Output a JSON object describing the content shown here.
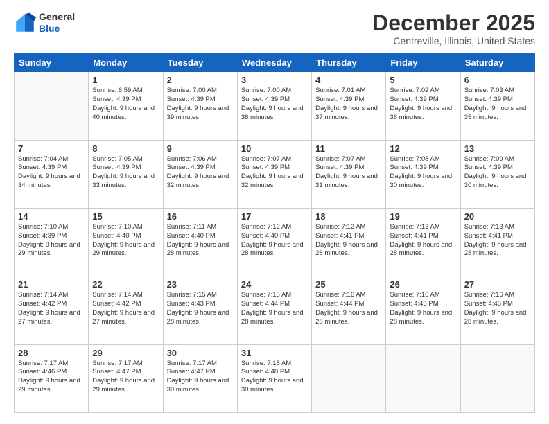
{
  "header": {
    "logo_general": "General",
    "logo_blue": "Blue",
    "month_year": "December 2025",
    "location": "Centreville, Illinois, United States"
  },
  "days_of_week": [
    "Sunday",
    "Monday",
    "Tuesday",
    "Wednesday",
    "Thursday",
    "Friday",
    "Saturday"
  ],
  "weeks": [
    [
      {
        "day": "",
        "sunrise": "",
        "sunset": "",
        "daylight": "",
        "empty": true
      },
      {
        "day": "1",
        "sunrise": "6:59 AM",
        "sunset": "4:39 PM",
        "daylight": "9 hours and 40 minutes."
      },
      {
        "day": "2",
        "sunrise": "7:00 AM",
        "sunset": "4:39 PM",
        "daylight": "9 hours and 39 minutes."
      },
      {
        "day": "3",
        "sunrise": "7:00 AM",
        "sunset": "4:39 PM",
        "daylight": "9 hours and 38 minutes."
      },
      {
        "day": "4",
        "sunrise": "7:01 AM",
        "sunset": "4:39 PM",
        "daylight": "9 hours and 37 minutes."
      },
      {
        "day": "5",
        "sunrise": "7:02 AM",
        "sunset": "4:39 PM",
        "daylight": "9 hours and 36 minutes."
      },
      {
        "day": "6",
        "sunrise": "7:03 AM",
        "sunset": "4:39 PM",
        "daylight": "9 hours and 35 minutes."
      }
    ],
    [
      {
        "day": "7",
        "sunrise": "7:04 AM",
        "sunset": "4:39 PM",
        "daylight": "9 hours and 34 minutes."
      },
      {
        "day": "8",
        "sunrise": "7:05 AM",
        "sunset": "4:39 PM",
        "daylight": "9 hours and 33 minutes."
      },
      {
        "day": "9",
        "sunrise": "7:06 AM",
        "sunset": "4:39 PM",
        "daylight": "9 hours and 32 minutes."
      },
      {
        "day": "10",
        "sunrise": "7:07 AM",
        "sunset": "4:39 PM",
        "daylight": "9 hours and 32 minutes."
      },
      {
        "day": "11",
        "sunrise": "7:07 AM",
        "sunset": "4:39 PM",
        "daylight": "9 hours and 31 minutes."
      },
      {
        "day": "12",
        "sunrise": "7:08 AM",
        "sunset": "4:39 PM",
        "daylight": "9 hours and 30 minutes."
      },
      {
        "day": "13",
        "sunrise": "7:09 AM",
        "sunset": "4:39 PM",
        "daylight": "9 hours and 30 minutes."
      }
    ],
    [
      {
        "day": "14",
        "sunrise": "7:10 AM",
        "sunset": "4:39 PM",
        "daylight": "9 hours and 29 minutes."
      },
      {
        "day": "15",
        "sunrise": "7:10 AM",
        "sunset": "4:40 PM",
        "daylight": "9 hours and 29 minutes."
      },
      {
        "day": "16",
        "sunrise": "7:11 AM",
        "sunset": "4:40 PM",
        "daylight": "9 hours and 28 minutes."
      },
      {
        "day": "17",
        "sunrise": "7:12 AM",
        "sunset": "4:40 PM",
        "daylight": "9 hours and 28 minutes."
      },
      {
        "day": "18",
        "sunrise": "7:12 AM",
        "sunset": "4:41 PM",
        "daylight": "9 hours and 28 minutes."
      },
      {
        "day": "19",
        "sunrise": "7:13 AM",
        "sunset": "4:41 PM",
        "daylight": "9 hours and 28 minutes."
      },
      {
        "day": "20",
        "sunrise": "7:13 AM",
        "sunset": "4:41 PM",
        "daylight": "9 hours and 28 minutes."
      }
    ],
    [
      {
        "day": "21",
        "sunrise": "7:14 AM",
        "sunset": "4:42 PM",
        "daylight": "9 hours and 27 minutes."
      },
      {
        "day": "22",
        "sunrise": "7:14 AM",
        "sunset": "4:42 PM",
        "daylight": "9 hours and 27 minutes."
      },
      {
        "day": "23",
        "sunrise": "7:15 AM",
        "sunset": "4:43 PM",
        "daylight": "9 hours and 28 minutes."
      },
      {
        "day": "24",
        "sunrise": "7:15 AM",
        "sunset": "4:44 PM",
        "daylight": "9 hours and 28 minutes."
      },
      {
        "day": "25",
        "sunrise": "7:16 AM",
        "sunset": "4:44 PM",
        "daylight": "9 hours and 28 minutes."
      },
      {
        "day": "26",
        "sunrise": "7:16 AM",
        "sunset": "4:45 PM",
        "daylight": "9 hours and 28 minutes."
      },
      {
        "day": "27",
        "sunrise": "7:16 AM",
        "sunset": "4:45 PM",
        "daylight": "9 hours and 28 minutes."
      }
    ],
    [
      {
        "day": "28",
        "sunrise": "7:17 AM",
        "sunset": "4:46 PM",
        "daylight": "9 hours and 29 minutes."
      },
      {
        "day": "29",
        "sunrise": "7:17 AM",
        "sunset": "4:47 PM",
        "daylight": "9 hours and 29 minutes."
      },
      {
        "day": "30",
        "sunrise": "7:17 AM",
        "sunset": "4:47 PM",
        "daylight": "9 hours and 30 minutes."
      },
      {
        "day": "31",
        "sunrise": "7:18 AM",
        "sunset": "4:48 PM",
        "daylight": "9 hours and 30 minutes."
      },
      {
        "day": "",
        "sunrise": "",
        "sunset": "",
        "daylight": "",
        "empty": true
      },
      {
        "day": "",
        "sunrise": "",
        "sunset": "",
        "daylight": "",
        "empty": true
      },
      {
        "day": "",
        "sunrise": "",
        "sunset": "",
        "daylight": "",
        "empty": true
      }
    ]
  ],
  "labels": {
    "sunrise_prefix": "Sunrise: ",
    "sunset_prefix": "Sunset: ",
    "daylight_prefix": "Daylight: "
  }
}
